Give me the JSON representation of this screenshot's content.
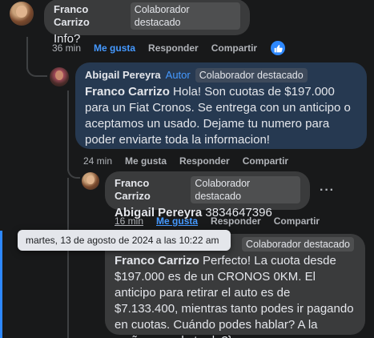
{
  "comment1": {
    "author": "Franco Carrizo",
    "badge": "Colaborador destacado",
    "text": "Info?",
    "time": "36 min",
    "like": "Me gusta",
    "reply": "Responder",
    "share": "Compartir"
  },
  "comment2": {
    "author": "Abigail Pereyra",
    "autor_label": "Autor",
    "badge": "Colaborador destacado",
    "mention": "Franco Carrizo",
    "text": "Hola! Son cuotas de $197.000 para un Fiat Cronos. Se entrega con un anticipo o aceptamos un usado. Dejame tu numero para poder enviarte toda la informacion!",
    "time": "24 min",
    "like": "Me gusta",
    "reply": "Responder",
    "share": "Compartir"
  },
  "comment3": {
    "author": "Franco Carrizo",
    "badge": "Colaborador destacado",
    "mention": "Abigail Pereyra",
    "text": "3834647396",
    "time": "16 min",
    "like": "Me gusta",
    "reply": "Responder",
    "share": "Compartir"
  },
  "comment4": {
    "badge": "Colaborador destacado",
    "mention": "Franco Carrizo",
    "text": "Perfecto! La cuota desde $197.000 es de un CRONOS 0KM. El anticipo para retirar el auto es de $7.133.400, mientras tanto podes ir pagando en cuotas. Cuándo podes hablar? A la mañana o a la tarde?}"
  },
  "tooltip": "martes, 13 de agosto de 2024 a las 10:22 am",
  "colors": {
    "accent": "#2d88ff",
    "bubble": "#3a3b3c",
    "highlight": "#263951"
  }
}
